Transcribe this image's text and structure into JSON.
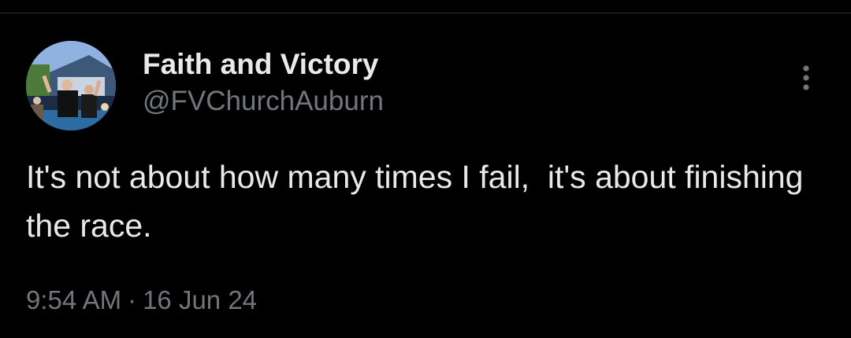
{
  "tweet": {
    "author": {
      "display_name": "Faith and Victory",
      "handle": "@FVChurchAuburn",
      "avatar_icon": "profile-photo"
    },
    "text": "It's not about how many times I fail,  it's about finishing the race.",
    "time": "9:54 AM",
    "separator": "·",
    "date": "16 Jun 24",
    "more_icon": "more-vertical-icon"
  },
  "colors": {
    "background": "#000000",
    "primary_text": "#e7e9ea",
    "secondary_text": "#71767b",
    "divider": "#2f3336"
  }
}
